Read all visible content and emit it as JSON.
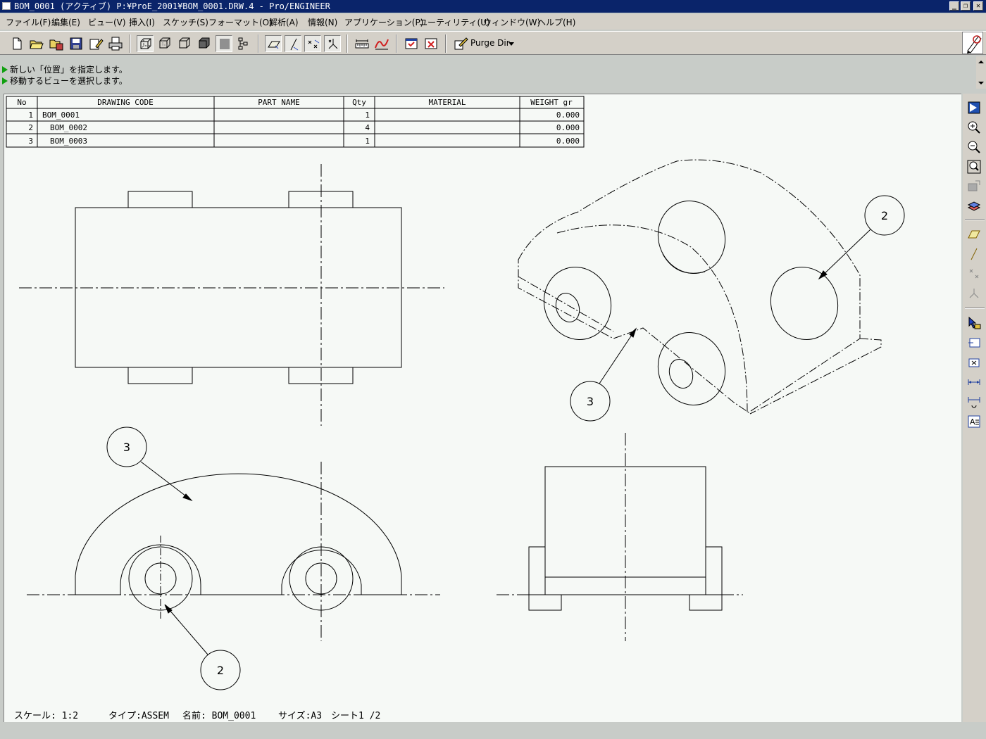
{
  "window": {
    "title": "BOM_0001 (アクティブ) P:¥ProE_2001¥BOM_0001.DRW.4 - Pro/ENGINEER",
    "controls": [
      "_",
      "❐",
      "✕"
    ]
  },
  "menu": {
    "items": [
      "ファイル(F)",
      "編集(E)",
      "ビュー(V)",
      "挿入(I)",
      "スケッチ(S)",
      "フォーマット(O)",
      "解析(A)",
      "情報(N)",
      "アプリケーション(P)",
      "ユーティリティ(U)",
      "ウィンドウ(W)",
      "ヘルプ(H)"
    ]
  },
  "toolbar": {
    "purge_label": "Purge Dir"
  },
  "messages": [
    "新しい「位置」を指定します。",
    "移動するビューを選択します。"
  ],
  "bom": {
    "headers": [
      "No",
      "DRAWING CODE",
      "PART NAME",
      "Qty",
      "MATERIAL",
      "WEIGHT gr"
    ],
    "rows": [
      {
        "no": "1",
        "code": "BOM_0001",
        "part": "",
        "qty": "1",
        "material": "",
        "weight": "0.000"
      },
      {
        "no": "2",
        "code": "BOM_0002",
        "part": "",
        "qty": "4",
        "material": "",
        "weight": "0.000"
      },
      {
        "no": "3",
        "code": "BOM_0003",
        "part": "",
        "qty": "1",
        "material": "",
        "weight": "0.000"
      }
    ]
  },
  "balloons": {
    "iso_part2": "2",
    "iso_part3": "3",
    "front_part3": "3",
    "front_part2": "2"
  },
  "status": {
    "scale": "スケール: 1:2",
    "type": "タイプ:ASSEM",
    "name": "名前: BOM_0001",
    "size": "サイズ:A3",
    "sheet": "シート1 /2"
  }
}
